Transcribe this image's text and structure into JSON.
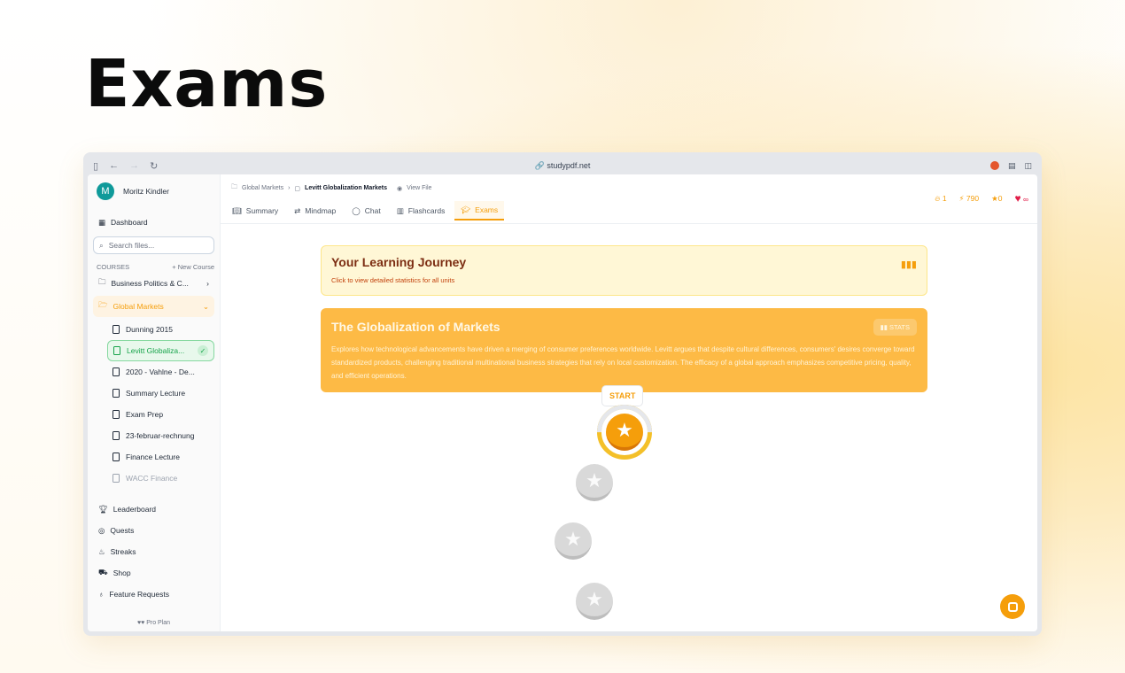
{
  "hero": {
    "title": "Exams"
  },
  "browser": {
    "url": "studypdf.net"
  },
  "sidebar": {
    "user_initial": "M",
    "user_name": "Moritz Kindler",
    "dashboard": "Dashboard",
    "search_placeholder": "Search files...",
    "courses_label": "COURSES",
    "new_course": "+ New Course",
    "courses": [
      {
        "label": "Business Politics & C..."
      },
      {
        "label": "Global Markets"
      }
    ],
    "files": [
      {
        "label": "Dunning 2015"
      },
      {
        "label": "Levitt Globaliza..."
      },
      {
        "label": "2020 - Vahlne - De..."
      },
      {
        "label": "Summary Lecture"
      },
      {
        "label": "Exam Prep"
      },
      {
        "label": "23-februar-rechnung"
      },
      {
        "label": "Finance Lecture"
      },
      {
        "label": "WACC Finance"
      }
    ],
    "bottom_nav": [
      {
        "label": "Leaderboard"
      },
      {
        "label": "Quests"
      },
      {
        "label": "Streaks"
      },
      {
        "label": "Shop"
      },
      {
        "label": "Feature Requests"
      }
    ],
    "plan": "Pro Plan"
  },
  "header": {
    "breadcrumb": {
      "course": "Global Markets",
      "file": "Levitt Globalization Markets",
      "view": "View File"
    },
    "tabs": [
      {
        "label": "Summary"
      },
      {
        "label": "Mindmap"
      },
      {
        "label": "Chat"
      },
      {
        "label": "Flashcards"
      },
      {
        "label": "Exams"
      }
    ],
    "stats": {
      "streak": "1",
      "xp": "790",
      "stars": "0",
      "hearts": "∞"
    }
  },
  "journey": {
    "title": "Your Learning Journey",
    "subtitle": "Click to view detailed statistics for all units"
  },
  "unit": {
    "title": "The Globalization of Markets",
    "stats_label": "STATS",
    "description": "Explores how technological advancements have driven a merging of consumer preferences worldwide. Levitt argues that despite cultural differences, consumers' desires converge toward standardized products, challenging traditional multinational business strategies that rely on local customization. The efficacy of a global approach emphasizes competitive pricing, quality, and efficient operations."
  },
  "path": {
    "start_label": "START"
  },
  "colors": {
    "accent": "#f59e0b",
    "success": "#16a34a"
  }
}
